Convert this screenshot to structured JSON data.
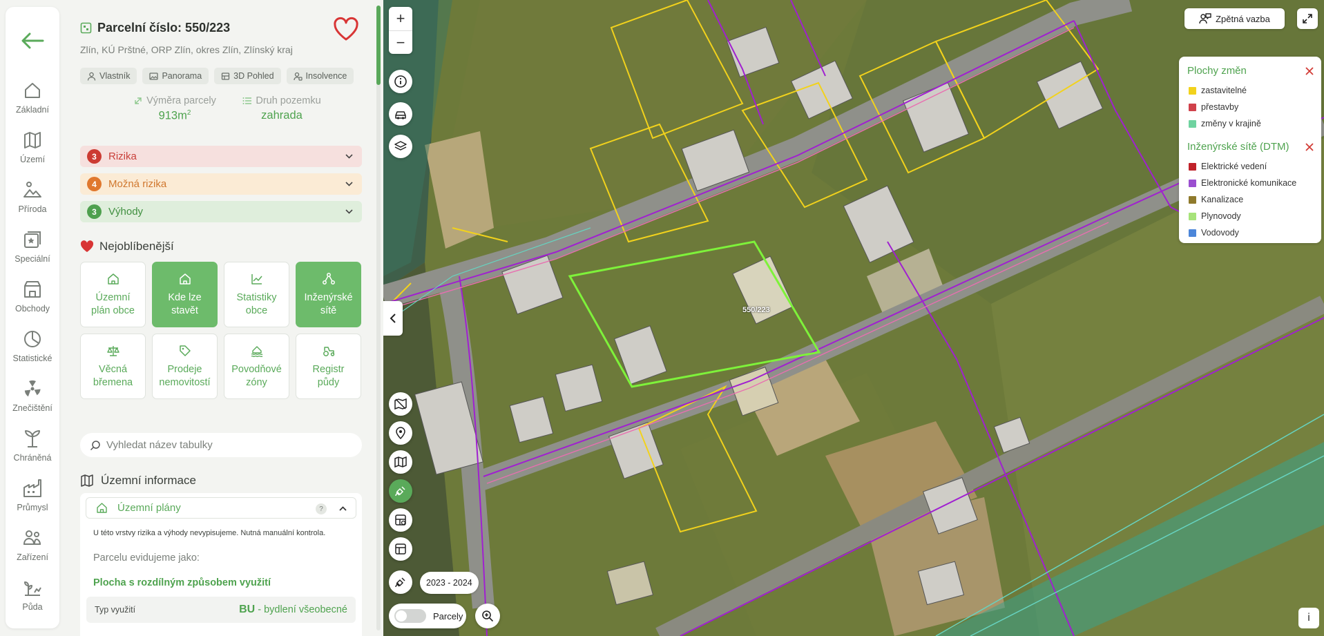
{
  "parcel": {
    "title": "Parcelní číslo: 550/223",
    "location": "Zlín, KÚ Prštné, ORP Zlín, okres Zlín, Zlínský kraj",
    "area_label": "Výměra parcely",
    "area_value": "913m",
    "area_unit_sup": "2",
    "type_label": "Druh pozemku",
    "type_value": "zahrada"
  },
  "chips": [
    "Vlastník",
    "Panorama",
    "3D Pohled",
    "Insolvence"
  ],
  "accordions": [
    {
      "count": "3",
      "label": "Rizika",
      "bg": "#f6e0de",
      "num_bg": "#cc3b33",
      "color": "#c9403a"
    },
    {
      "count": "4",
      "label": "Možná rizika",
      "bg": "#fbebd5",
      "num_bg": "#e0782e",
      "color": "#d0772e"
    },
    {
      "count": "3",
      "label": "Výhody",
      "bg": "#dfeedc",
      "num_bg": "#4ea04e",
      "color": "#3f8f3f"
    }
  ],
  "favorites_title": "Nejoblíbenější",
  "tiles": [
    {
      "line1": "Územní",
      "line2": "plán obce"
    },
    {
      "line1": "Kde lze",
      "line2": "stavět"
    },
    {
      "line1": "Statistiky",
      "line2": "obce"
    },
    {
      "line1": "Inženýrské",
      "line2": "sítě"
    },
    {
      "line1": "Věcná",
      "line2": "břemena"
    },
    {
      "line1": "Prodeje",
      "line2": "nemovitostí"
    },
    {
      "line1": "Povodňové",
      "line2": "zóny"
    },
    {
      "line1": "Registr",
      "line2": "půdy"
    }
  ],
  "search_placeholder": "Vyhledat název tabulky",
  "section_title": "Územní informace",
  "subsection": {
    "label": "Územní plány",
    "help": "?",
    "note": "U této vrstvy rizika a výhody nevypisujeme. Nutná manuální kontrola.",
    "evidence": "Parcelu evidujeme jako:",
    "plot": "Plocha s rozdílným způsobem využití",
    "use_key": "Typ využití",
    "use_code": "BU",
    "use_desc": " - bydlení všeobecné"
  },
  "nav": [
    {
      "label": "Základní",
      "icon": "home-icon"
    },
    {
      "label": "Území",
      "icon": "map-icon"
    },
    {
      "label": "Příroda",
      "icon": "nature-icon"
    },
    {
      "label": "Speciální",
      "icon": "special-icon"
    },
    {
      "label": "Obchody",
      "icon": "shop-icon"
    },
    {
      "label": "Statistické",
      "icon": "chart-pie-icon"
    },
    {
      "label": "Znečištění",
      "icon": "radiation-icon"
    },
    {
      "label": "Chráněná",
      "icon": "protected-tree-icon"
    },
    {
      "label": "Průmysl",
      "icon": "factory-icon"
    },
    {
      "label": "Zařízení",
      "icon": "facilities-icon"
    },
    {
      "label": "Půda",
      "icon": "soil-icon"
    }
  ],
  "map": {
    "zoom_in": "+",
    "zoom_out": "−",
    "years": "2023 - 2024",
    "parcels_toggle": "Parcely",
    "parcel_label": "550/223",
    "feedback": "Zpětná vazba",
    "info": "i"
  },
  "legend": {
    "group1": {
      "title": "Plochy změn",
      "items": [
        {
          "label": "zastavitelné",
          "color": "#f2d21c"
        },
        {
          "label": "přestavby",
          "color": "#d0414b"
        },
        {
          "label": "změny v krajině",
          "color": "#6fd3a0"
        }
      ]
    },
    "group2": {
      "title": "Inženýrské sítě (DTM)",
      "items": [
        {
          "label": "Elektrické vedení",
          "color": "#c0222a"
        },
        {
          "label": "Elektronické komunikace",
          "color": "#9b4fd0"
        },
        {
          "label": "Kanalizace",
          "color": "#8f7a2c"
        },
        {
          "label": "Plynovody",
          "color": "#a7e37a"
        },
        {
          "label": "Vodovody",
          "color": "#4c86d9"
        }
      ]
    }
  },
  "colors": {
    "accent": "#5aaa5a",
    "heart": "#d83535"
  }
}
